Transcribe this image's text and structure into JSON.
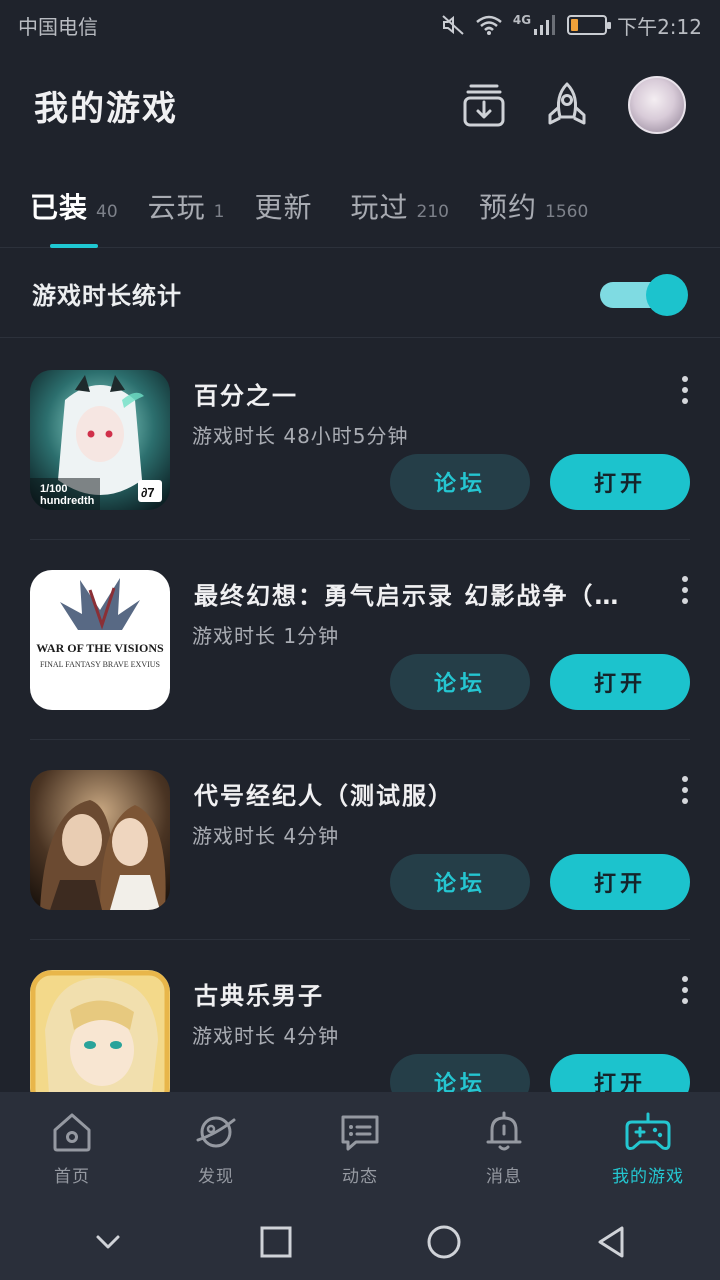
{
  "status_bar": {
    "carrier": "中国电信",
    "network": "4G",
    "time": "下午2:12",
    "battery_level": 0.22
  },
  "header": {
    "title": "我的游戏"
  },
  "tabs": [
    {
      "label": "已装",
      "count": "40",
      "active": true
    },
    {
      "label": "云玩",
      "count": "1",
      "active": false
    },
    {
      "label": "更新",
      "count": "",
      "active": false
    },
    {
      "label": "玩过",
      "count": "210",
      "active": false
    },
    {
      "label": "预约",
      "count": "1560",
      "active": false
    }
  ],
  "stats": {
    "label": "游戏时长统计",
    "enabled": true
  },
  "games": [
    {
      "title": "百分之一",
      "playtime": "游戏时长 48小时5分钟",
      "forum_label": "论坛",
      "open_label": "打开",
      "icon": "game-icon-one-percent"
    },
    {
      "title": "最终幻想：勇气启示录 幻影战争（…",
      "playtime": "游戏时长 1分钟",
      "forum_label": "论坛",
      "open_label": "打开",
      "icon": "game-icon-war-of-the-visions",
      "icon_text_1": "WAR OF THE VISIONS",
      "icon_text_2": "FINAL FANTASY BRAVE EXVIUS"
    },
    {
      "title": "代号经纪人（测试服）",
      "playtime": "游戏时长 4分钟",
      "forum_label": "论坛",
      "open_label": "打开",
      "icon": "game-icon-agent"
    },
    {
      "title": "古典乐男子",
      "playtime": "游戏时长 4分钟",
      "forum_label": "论坛",
      "open_label": "打开",
      "icon": "game-icon-classical-boys"
    }
  ],
  "bottom_nav": [
    {
      "label": "首页",
      "icon": "home-icon",
      "active": false
    },
    {
      "label": "发现",
      "icon": "planet-icon",
      "active": false
    },
    {
      "label": "动态",
      "icon": "message-icon",
      "active": false
    },
    {
      "label": "消息",
      "icon": "bell-icon",
      "active": false
    },
    {
      "label": "我的游戏",
      "icon": "gamepad-icon",
      "active": true
    }
  ],
  "colors": {
    "accent": "#1cc3cd",
    "background": "#1f232c",
    "nav_background": "#2a2f3a"
  }
}
